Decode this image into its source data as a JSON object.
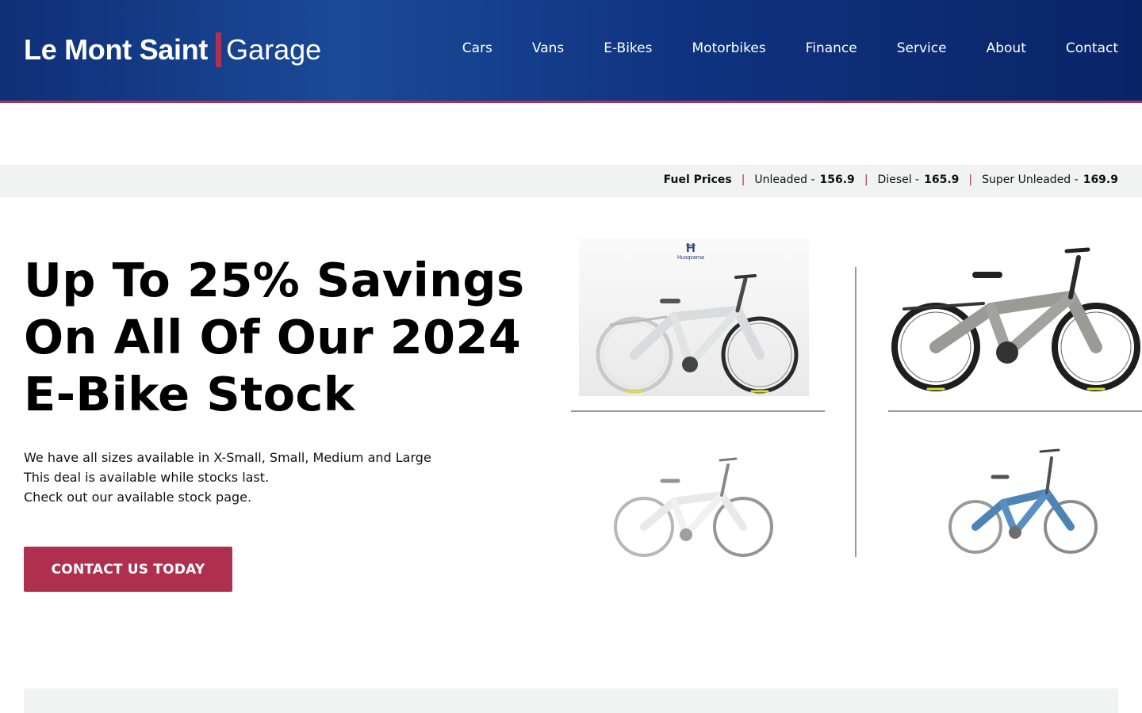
{
  "header": {
    "logo_main": "Le Mont Saint",
    "logo_sub": "Garage",
    "nav": [
      "Cars",
      "Vans",
      "E-Bikes",
      "Motorbikes",
      "Finance",
      "Service",
      "About",
      "Contact"
    ]
  },
  "fuel": {
    "label": "Fuel Prices",
    "separator": "|",
    "unleaded_label": "Unleaded -",
    "unleaded_value": "156.9",
    "diesel_label": "Diesel -",
    "diesel_value": "165.9",
    "super_label": "Super Unleaded -",
    "super_value": "169.9"
  },
  "hero": {
    "title": "Up To 25% Savings On All Of Our 2024 E-Bike Stock",
    "lines": [
      "We have all sizes available in X-Small, Small, Medium and Large",
      "This deal is available while stocks last.",
      "Check out our available stock page."
    ],
    "cta": "CONTACT US TODAY"
  },
  "bikes": {
    "brand": "Husqvarna",
    "colors": {
      "white_bike": "#e8e8e8",
      "grey_bike": "#9b9b95",
      "blue_bike": "#2f6fa8",
      "accent_yellow": "#d6e03a"
    }
  },
  "colors": {
    "brand_red": "#ae2f4e",
    "header_blue": "#123a86",
    "fuel_bg": "#f1f3f2"
  }
}
